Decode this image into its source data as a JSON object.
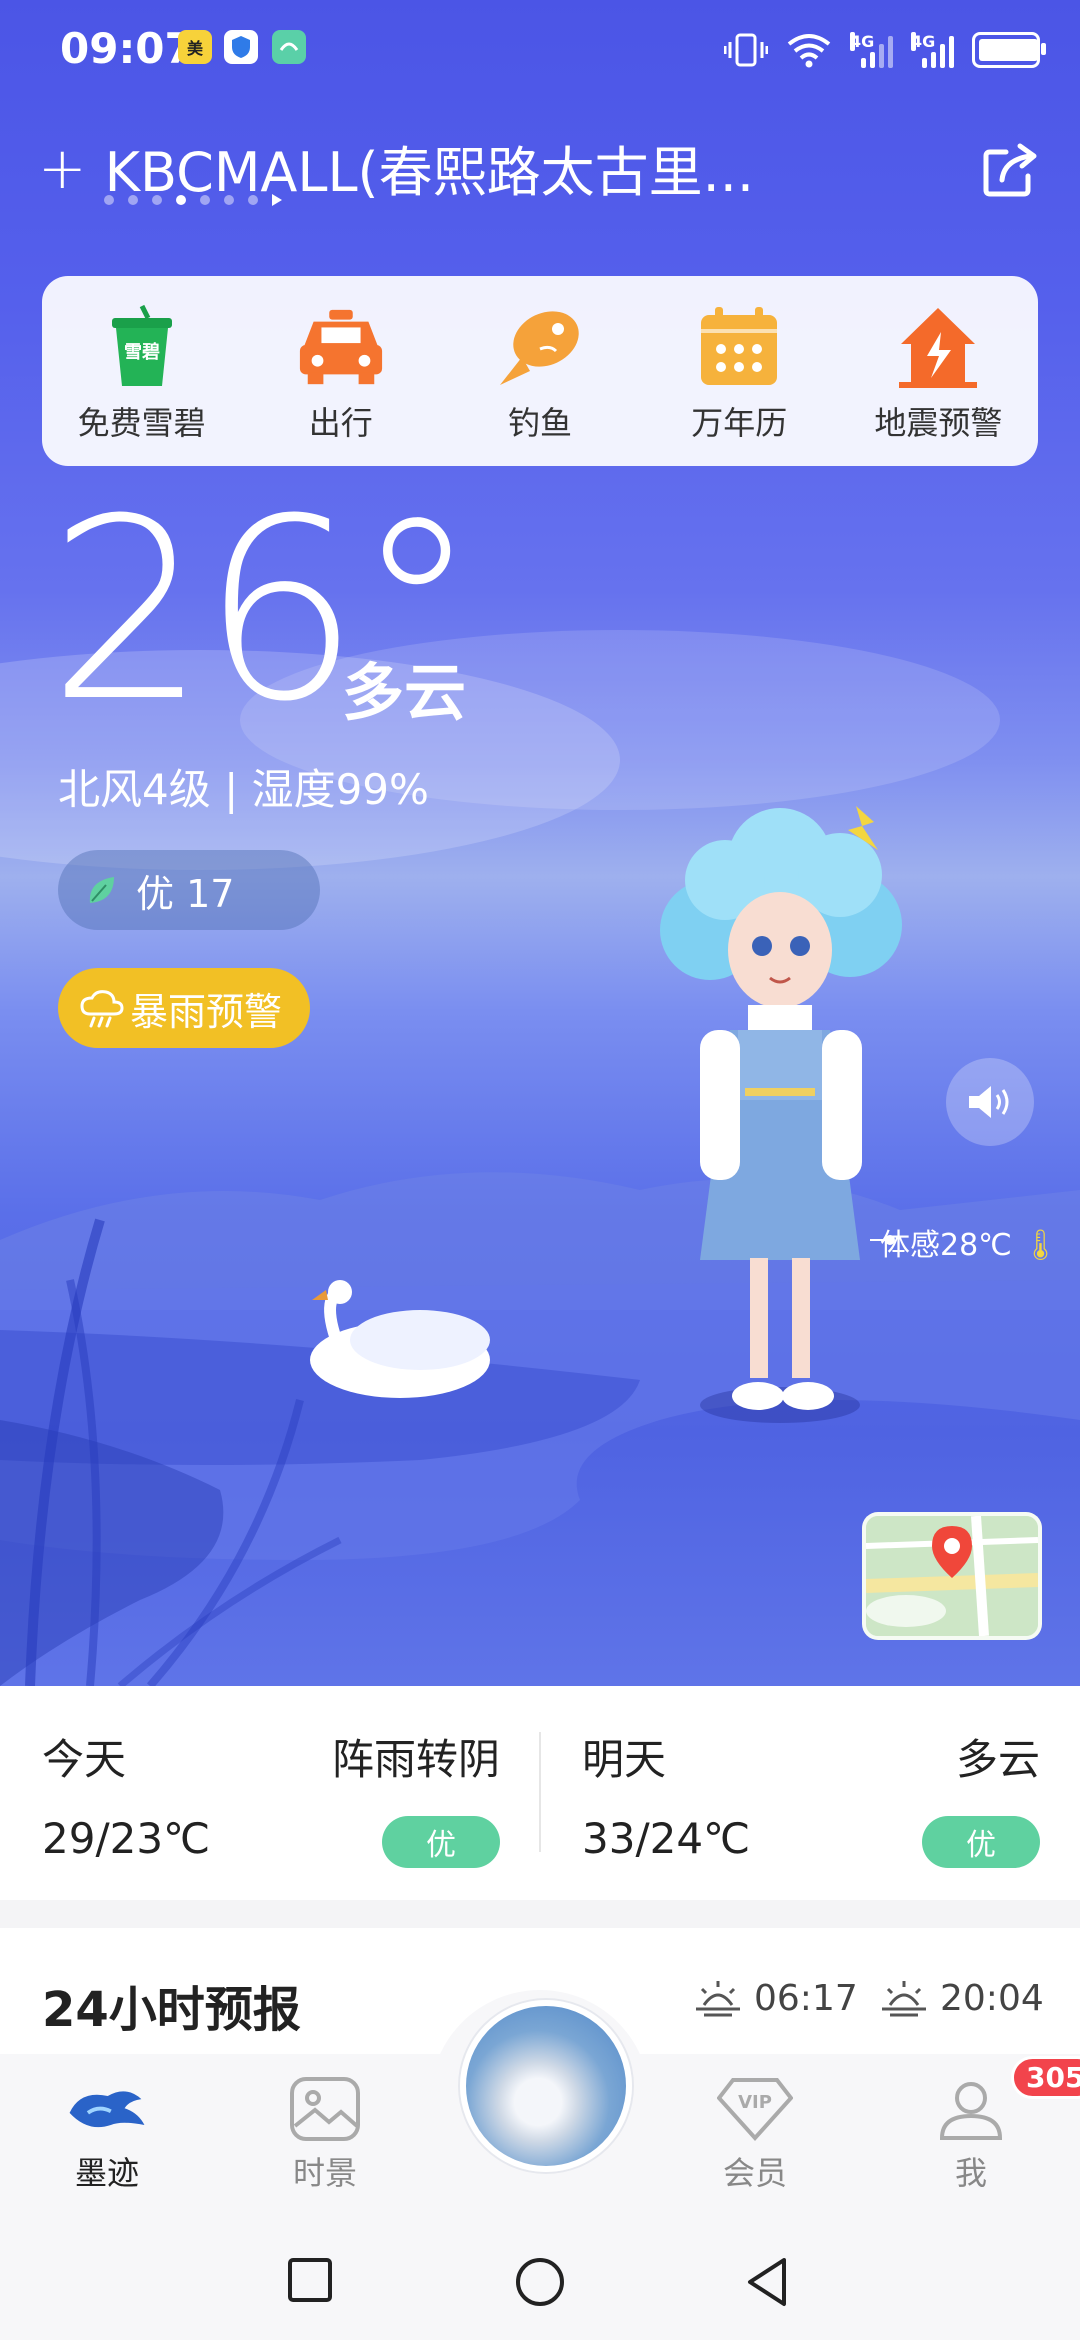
{
  "status_bar": {
    "time": "09:07",
    "net1": "4G",
    "net2": "4G",
    "battery_level": 0.95
  },
  "header": {
    "add_symbol": "+",
    "location": "KBCMALL(春熙路太古里...",
    "page_count": 7,
    "active_page": 3
  },
  "tools": [
    {
      "label": "免费雪碧",
      "icon": "cup-icon",
      "icon_text": "雪碧"
    },
    {
      "label": "出行",
      "icon": "taxi-icon"
    },
    {
      "label": "钓鱼",
      "icon": "fish-icon"
    },
    {
      "label": "万年历",
      "icon": "calendar-icon"
    },
    {
      "label": "地震预警",
      "icon": "earthquake-house-icon"
    }
  ],
  "current": {
    "temperature": "26°",
    "condition": "多云",
    "wind_humidity": "北风4级 | 湿度99%",
    "aqi_text": "优 17",
    "warning": "暴雨预警",
    "feels_like": "体感28℃"
  },
  "forecast": [
    {
      "day": "今天",
      "condition": "阵雨转阴",
      "temps": "29/23℃",
      "aqi": "优"
    },
    {
      "day": "明天",
      "condition": "多云",
      "temps": "33/24℃",
      "aqi": "优"
    }
  ],
  "hourly": {
    "title": "24小时预报",
    "sunrise": "06:17",
    "sunset": "20:04"
  },
  "bottom_nav": [
    {
      "label": "墨迹",
      "icon": "moji-logo-icon"
    },
    {
      "label": "时景",
      "icon": "photo-icon"
    },
    {
      "label": "会员",
      "icon": "vip-icon",
      "icon_text": "VIP"
    },
    {
      "label": "我",
      "icon": "user-icon",
      "badge": "305"
    }
  ],
  "colors": {
    "accent_blue": "#4b55e6",
    "warning_yellow": "#f2c025",
    "aqi_green": "#5fd1a0",
    "badge_red": "#f2444c"
  }
}
